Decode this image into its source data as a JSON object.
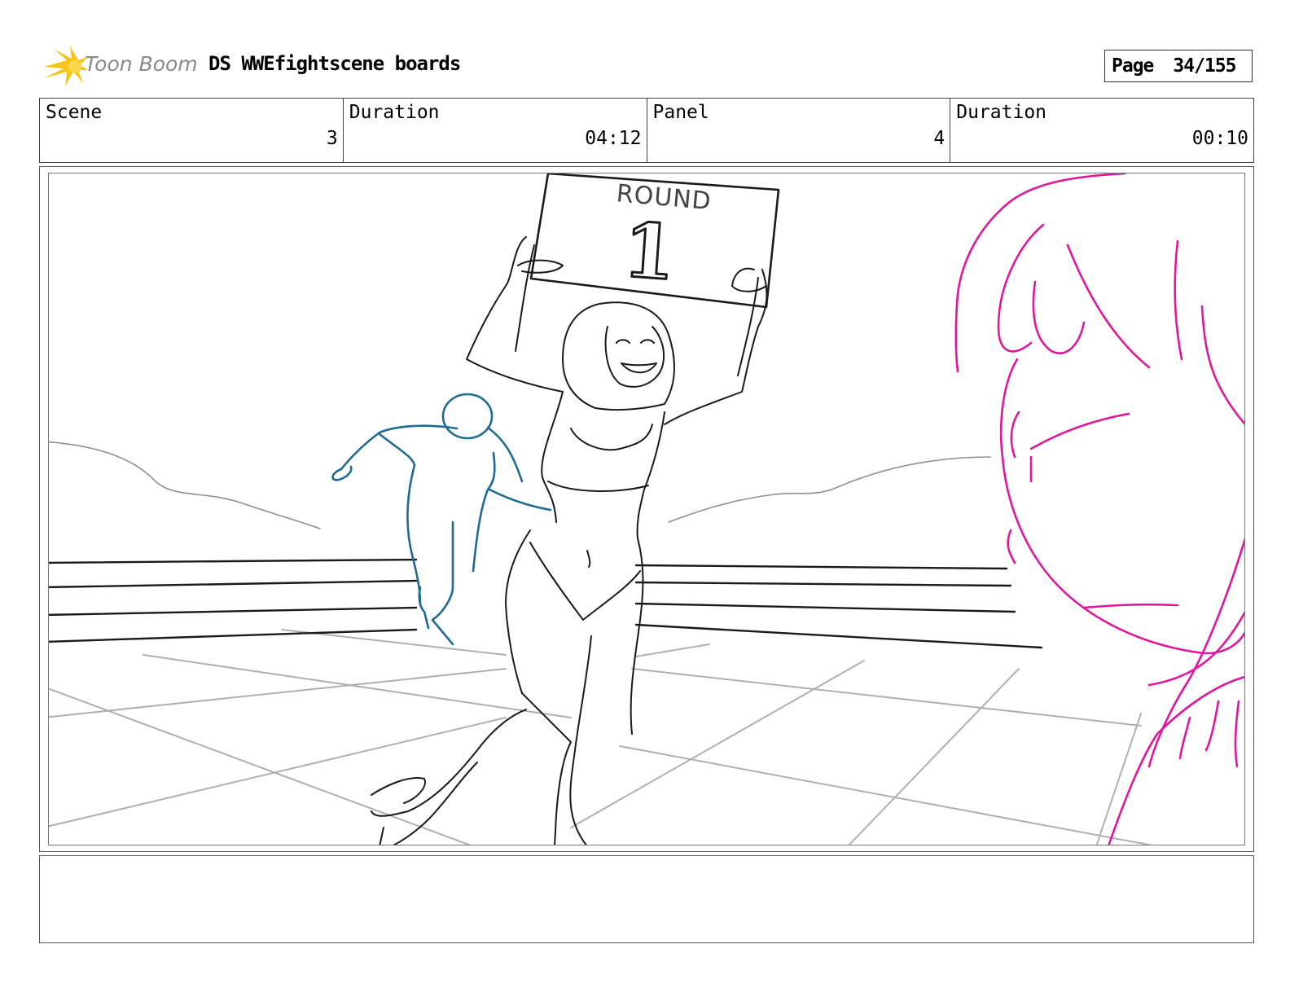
{
  "header": {
    "logo_text": "Toon Boom",
    "title": "DS WWEfightscene boards",
    "page_label": "Page",
    "page_value": "34/155"
  },
  "info": {
    "scene_label": "Scene",
    "scene_value": "3",
    "scene_duration_label": "Duration",
    "scene_duration_value": "04:12",
    "panel_label": "Panel",
    "panel_value": "4",
    "panel_duration_label": "Duration",
    "panel_duration_value": "00:10"
  },
  "sketch": {
    "sign_word": "ROUND",
    "sign_number": "1",
    "colors": {
      "ink": "#1a1a1a",
      "floor": "#a8a8a8",
      "figure": "#1f6a93",
      "foreground": "#e0179c",
      "logo_flame": "#f5c518"
    }
  },
  "notes": {
    "text": ""
  }
}
